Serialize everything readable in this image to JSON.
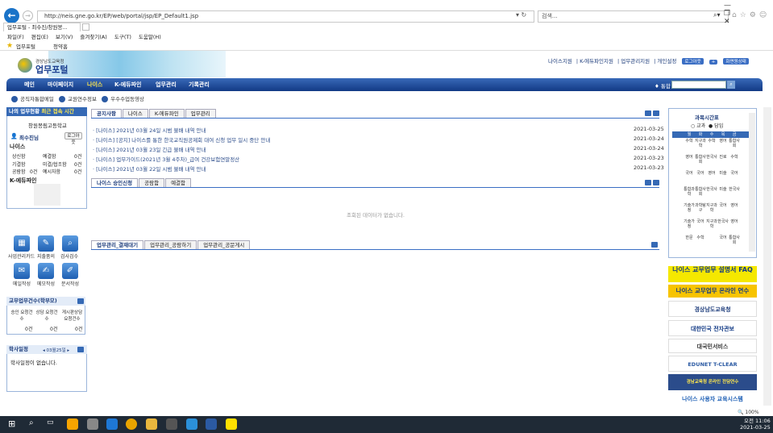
{
  "browser": {
    "url": "http://neis.gne.go.kr/EP/web/portal/jsp/EP_Default1.jsp",
    "search_placeholder": "검색...",
    "tab_title": "업무포털 - 최수진/창원봉...",
    "tab_close": "×",
    "win_controls": "— ❐ ✕",
    "menu": [
      "파일(F)",
      "편집(E)",
      "보기(V)",
      "즐겨찾기(A)",
      "도구(T)",
      "도움말(H)"
    ],
    "favorites": [
      "업무포털",
      "청약홈"
    ],
    "zoom": "100%"
  },
  "portal": {
    "logo_sub": "경상남도교육청",
    "logo_main": "업무포털",
    "top_links": [
      "나이스지원",
      "K-에듀파인지원",
      "업무관리지원",
      "개인설정"
    ],
    "top_buttons": [
      "로그아웃",
      "+",
      "화면원상태"
    ],
    "gnb": [
      "메인",
      "마이페이지",
      "나이스",
      "K-에듀파인",
      "업무관리",
      "기록관리"
    ],
    "gnb_selected": "나이스",
    "gnb_search_label": "통합",
    "quick_links": [
      "공직자통합메일",
      "교원연수정보",
      "우수수업동영상"
    ]
  },
  "login": {
    "header": "나의 업무현황",
    "header_sub": "최근 접속 시간",
    "school": "창원봉림고등학교",
    "user": "최수진님",
    "logout": "로그아웃",
    "neis": "나이스",
    "stats": [
      [
        "상신함",
        "예결함",
        "0건"
      ],
      [
        "기결함",
        "미결/협조함",
        "0건"
      ],
      [
        "공람함",
        "0건",
        "예시자함",
        "0건"
      ]
    ],
    "kedu": "K-에듀파인"
  },
  "icons": [
    {
      "label": "사업관리카드",
      "glyph": "▦"
    },
    {
      "label": "지출품의",
      "glyph": "✎"
    },
    {
      "label": "검사검수",
      "glyph": "⌕"
    },
    {
      "label": "메일작성",
      "glyph": "✉"
    },
    {
      "label": "메모작성",
      "glyph": "✍"
    },
    {
      "label": "문서작성",
      "glyph": "✐"
    }
  ],
  "work": {
    "title": "교무업무건수(학부모)",
    "cols": [
      "승인 요청건수",
      "상담 요청건수",
      "게시판상담 요청건수"
    ],
    "vals": [
      "0건",
      "0건",
      "0건"
    ]
  },
  "schedule": {
    "title": "학사일정",
    "date": "03월25일",
    "empty": "학사일정이 없습니다."
  },
  "notices": {
    "tabs": [
      "공지사항",
      "나이스",
      "K-에듀파인",
      "업무관리"
    ],
    "items": [
      {
        "text": "· [나이스] 2021년 03월 24일 시범 불배 내역 안내",
        "date": "2021-03-25"
      },
      {
        "text": "· [나이스] [공지] 나이스를 통한 한국교직원공제회 대여 신청 업무 일시 중단 안내",
        "date": "2021-03-24"
      },
      {
        "text": "· [나이스] 2021년 03월 23일 긴급 불배 내역 안내",
        "date": "2021-03-24"
      },
      {
        "text": "· [나이스] 업무가이드(2021년 3월 4주차)_급여 건강보험연말정산",
        "date": "2021-03-23"
      },
      {
        "text": "· [나이스] 2021년 03월 22일 시범 불배 내역 안내",
        "date": "2021-03-23"
      }
    ]
  },
  "approval": {
    "tabs": [
      "나이스 승인신청",
      "공람함",
      "예결함"
    ],
    "empty": "조회된 데이터가 없습니다."
  },
  "board": {
    "tabs": [
      "업무관리_결재대기",
      "업무관리_공람하기",
      "업무관리_공문게시"
    ]
  },
  "timetable": {
    "title": "과목시간표",
    "radio": [
      "교과",
      "담임"
    ],
    "days": [
      "월",
      "화",
      "수",
      "목",
      "금"
    ],
    "rows": [
      [
        "수학",
        "지구과학",
        "수학",
        "영어",
        "통합사회"
      ],
      [
        "영어",
        "통합사회",
        "한국사",
        "진로",
        "수학"
      ],
      [
        "국어",
        "국어",
        "영어",
        "미술",
        "국어"
      ],
      [
        "통합과학",
        "통합사회",
        "한국사",
        "미술",
        "한국사"
      ],
      [
        "기술가정",
        "과학탐구",
        "지구과학",
        "국어",
        "영어"
      ],
      [
        "기술가정",
        "국어",
        "지구과학",
        "한국사",
        "영어"
      ],
      [
        "한문",
        "수학",
        "",
        "국어",
        "통합사회"
      ]
    ]
  },
  "banners": [
    "나이스 교무업무 설명서 FAQ",
    "나이스 교무업무 온라인 연수",
    "경상남도교육청",
    "대한민국 전자관보",
    "대국민서비스",
    "EDUNET T-CLEAR",
    "경남교육청 온라인 전담연수",
    "나이스 사용자 교육시스템"
  ],
  "clock": {
    "time": "오전 11:06",
    "date": "2021-03-25"
  }
}
